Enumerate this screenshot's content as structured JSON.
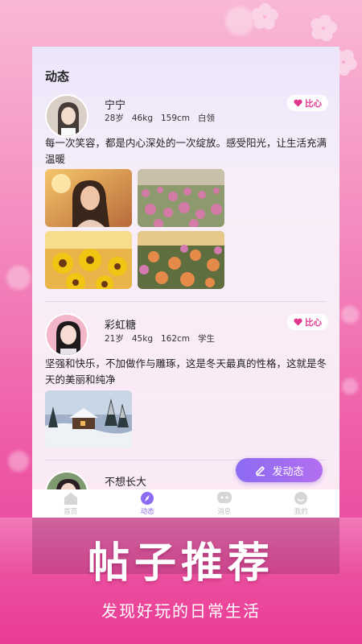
{
  "page": {
    "title": "动态"
  },
  "posts": [
    {
      "name": "宁宁",
      "age": "28岁",
      "weight": "46kg",
      "height": "159cm",
      "job": "白领",
      "like_label": "比心",
      "text": "每一次笑容，都是内心深处的一次绽放。感受阳光，让生活充满温暖",
      "photos": [
        "portrait-photo",
        "pink-flower-field-photo",
        "sunflower-photo",
        "cosmos-flower-photo"
      ]
    },
    {
      "name": "彩虹糖",
      "age": "21岁",
      "weight": "45kg",
      "height": "162cm",
      "job": "学生",
      "like_label": "比心",
      "text": "坚强和快乐，不加做作与雕琢，这是冬天最真的性格，这就是冬天的美丽和纯净",
      "photos": [
        "snowy-cabin-photo"
      ]
    },
    {
      "name": "不想长大"
    }
  ],
  "fab": {
    "label": "发动态",
    "icon": "pencil-icon"
  },
  "tabs": [
    {
      "label": "首页",
      "icon": "home-icon"
    },
    {
      "label": "动态",
      "icon": "compass-icon"
    },
    {
      "label": "消息",
      "icon": "chat-icon"
    },
    {
      "label": "我的",
      "icon": "profile-icon"
    }
  ],
  "banner": {
    "headline": "帖子推荐",
    "subline": "发现好玩的日常生活"
  },
  "colors": {
    "accent": "#8b6cf2",
    "like": "#e0368f",
    "brand_pink": "#ee5aa6"
  }
}
